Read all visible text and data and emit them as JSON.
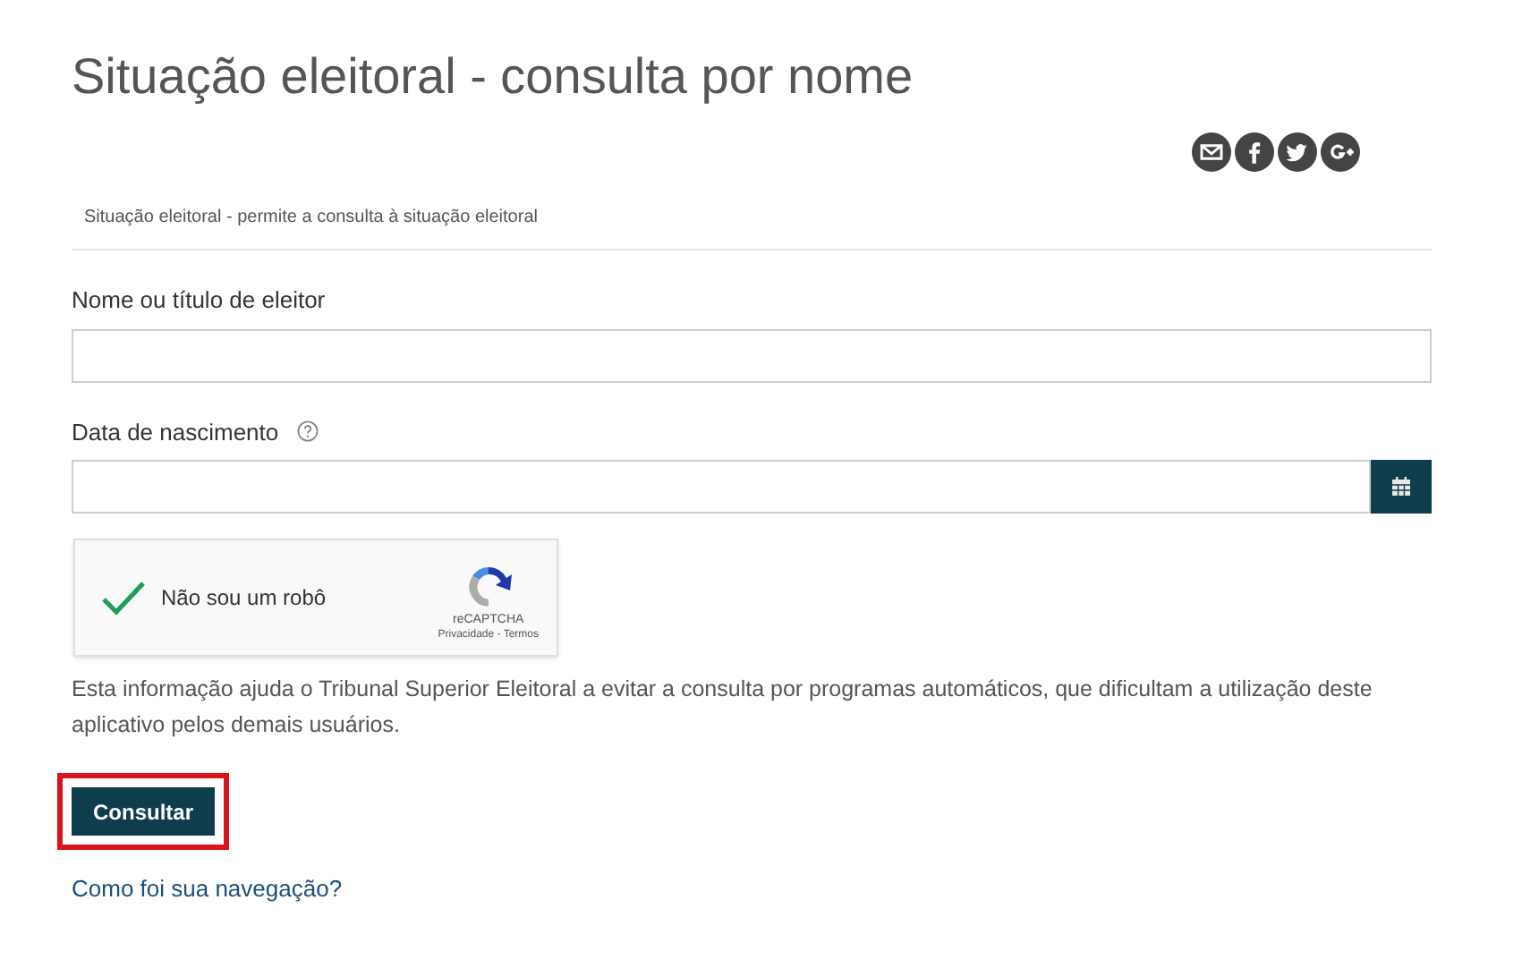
{
  "title": "Situação eleitoral - consulta por nome",
  "share_icons": [
    {
      "kind": "email"
    },
    {
      "kind": "facebook"
    },
    {
      "kind": "twitter"
    },
    {
      "kind": "google"
    }
  ],
  "subtitle": "Situação eleitoral - permite a consulta à situação eleitoral",
  "fields": [
    {
      "label": "Nome ou título de eleitor",
      "kind": "text",
      "help": false
    },
    {
      "label": "Data de nascimento",
      "kind": "date",
      "help": true
    }
  ],
  "captcha": {
    "label": "Não sou um robô",
    "checked": true,
    "brand": "reCAPTCHA",
    "links": "Privacidade - Termos"
  },
  "info": "Esta informação ajuda o Tribunal Superior Eleitoral a evitar a consulta por programas automáticos, que dificultam a utilização deste aplicativo pelos demais usuários.",
  "submit": {
    "label": "Consultar",
    "highlighted": true
  },
  "feedback_link": "Como foi sua navegação?"
}
